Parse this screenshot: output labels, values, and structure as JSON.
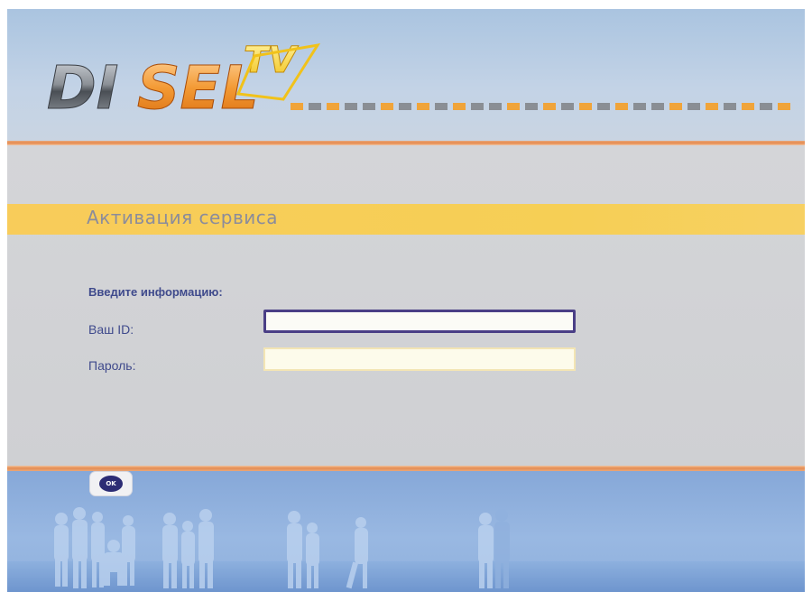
{
  "header": {
    "logo_text": "DISEL",
    "logo_accent": "TV"
  },
  "dialog": {
    "title": "Активация сервиса",
    "prompt": "Введите информацию:",
    "fields": [
      {
        "label": "Ваш ID:",
        "value": "",
        "placeholder": ""
      },
      {
        "label": "Пароль:",
        "value": "",
        "placeholder": ""
      }
    ]
  },
  "footer": {
    "ok_label": "OK",
    "ok_icon": "ok-remote-button-icon"
  },
  "colors": {
    "accent_orange": "#e6894d",
    "title_band": "#f6cf55",
    "label_text": "#3f4a8c",
    "sky": "#99b8e2"
  }
}
